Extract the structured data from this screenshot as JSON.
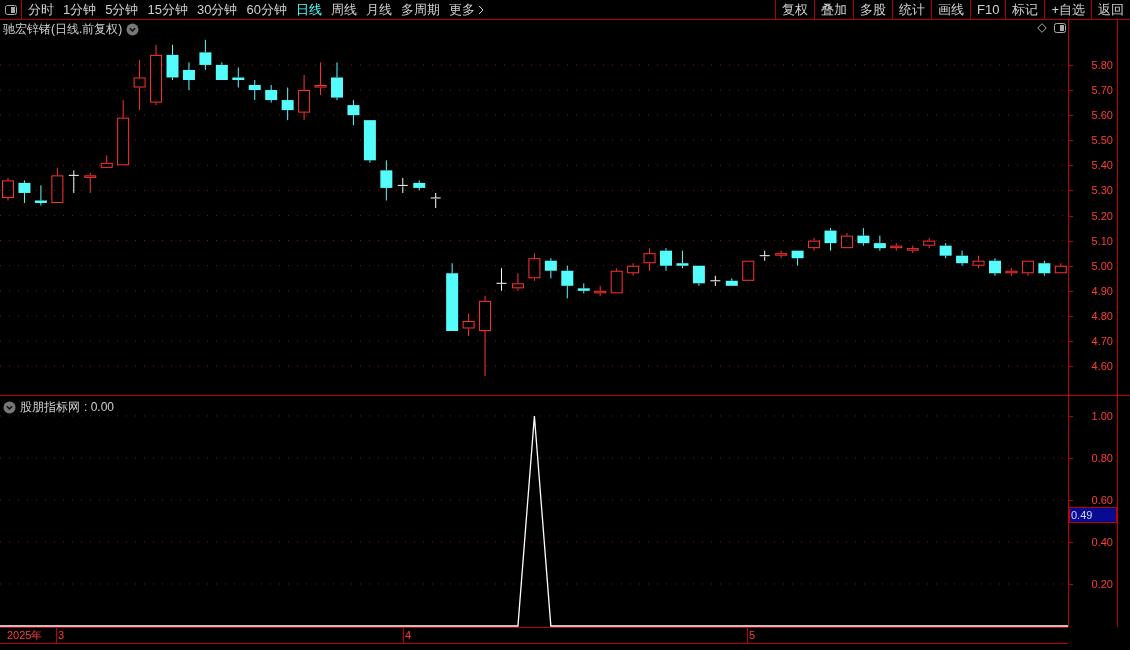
{
  "toolbar": {
    "periods": [
      {
        "label": "分时",
        "selected": false
      },
      {
        "label": "1分钟",
        "selected": false
      },
      {
        "label": "5分钟",
        "selected": false
      },
      {
        "label": "15分钟",
        "selected": false
      },
      {
        "label": "30分钟",
        "selected": false
      },
      {
        "label": "60分钟",
        "selected": false
      },
      {
        "label": "日线",
        "selected": true
      },
      {
        "label": "周线",
        "selected": false
      },
      {
        "label": "月线",
        "selected": false
      },
      {
        "label": "多周期",
        "selected": false
      }
    ],
    "more": "更多",
    "buttons": [
      "复权",
      "叠加",
      "多股",
      "统计",
      "画线",
      "F10",
      "标记",
      "+自选",
      "返回"
    ]
  },
  "main_panel": {
    "title": "驰宏锌锗(日线.前复权)",
    "chart_data": {
      "type": "candlestick",
      "grid": true,
      "ylim": [
        4.485,
        5.979
      ],
      "ohlc": [
        [
          5.27,
          5.35,
          5.26,
          5.34
        ],
        [
          5.33,
          5.34,
          5.25,
          5.29
        ],
        [
          5.26,
          5.32,
          5.24,
          5.25
        ],
        [
          5.25,
          5.39,
          5.25,
          5.36
        ],
        [
          5.36,
          5.38,
          5.29,
          5.36
        ],
        [
          5.35,
          5.37,
          5.29,
          5.36
        ],
        [
          5.39,
          5.44,
          5.39,
          5.41
        ],
        [
          5.4,
          5.66,
          5.4,
          5.59
        ],
        [
          5.71,
          5.82,
          5.62,
          5.75
        ],
        [
          5.65,
          5.88,
          5.64,
          5.84
        ],
        [
          5.84,
          5.88,
          5.74,
          5.75
        ],
        [
          5.78,
          5.81,
          5.7,
          5.74
        ],
        [
          5.85,
          5.9,
          5.78,
          5.8
        ],
        [
          5.8,
          5.81,
          5.74,
          5.74
        ],
        [
          5.75,
          5.79,
          5.71,
          5.74
        ],
        [
          5.72,
          5.74,
          5.66,
          5.7
        ],
        [
          5.7,
          5.72,
          5.65,
          5.66
        ],
        [
          5.66,
          5.71,
          5.58,
          5.62
        ],
        [
          5.61,
          5.76,
          5.58,
          5.7
        ],
        [
          5.71,
          5.81,
          5.68,
          5.72
        ],
        [
          5.75,
          5.81,
          5.66,
          5.67
        ],
        [
          5.64,
          5.66,
          5.56,
          5.6
        ],
        [
          5.58,
          5.58,
          5.41,
          5.42
        ],
        [
          5.38,
          5.42,
          5.26,
          5.31
        ],
        [
          5.32,
          5.35,
          5.29,
          5.32
        ],
        [
          5.33,
          5.34,
          5.3,
          5.31
        ],
        [
          5.27,
          5.29,
          5.23,
          5.27
        ],
        [
          4.97,
          5.01,
          4.74,
          4.74
        ],
        [
          4.75,
          4.81,
          4.72,
          4.78
        ],
        [
          4.74,
          4.88,
          4.56,
          4.86
        ],
        [
          4.93,
          4.99,
          4.9,
          4.93
        ],
        [
          4.91,
          4.97,
          4.9,
          4.93
        ],
        [
          4.95,
          5.05,
          4.94,
          5.03
        ],
        [
          5.02,
          5.03,
          4.95,
          4.98
        ],
        [
          4.98,
          5.0,
          4.87,
          4.92
        ],
        [
          4.91,
          4.93,
          4.89,
          4.9
        ],
        [
          4.89,
          4.92,
          4.88,
          4.9
        ],
        [
          4.89,
          4.99,
          4.89,
          4.98
        ],
        [
          4.97,
          5.01,
          4.96,
          5.0
        ],
        [
          5.01,
          5.07,
          4.98,
          5.05
        ],
        [
          5.06,
          5.07,
          4.98,
          5.0
        ],
        [
          5.01,
          5.06,
          4.99,
          5.0
        ],
        [
          5.0,
          5.0,
          4.92,
          4.93
        ],
        [
          4.94,
          4.96,
          4.92,
          4.94
        ],
        [
          4.94,
          4.95,
          4.92,
          4.92
        ],
        [
          4.94,
          5.02,
          4.94,
          5.02
        ],
        [
          5.04,
          5.06,
          5.02,
          5.04
        ],
        [
          5.04,
          5.06,
          5.03,
          5.05
        ],
        [
          5.06,
          5.06,
          5.0,
          5.03
        ],
        [
          5.07,
          5.11,
          5.06,
          5.1
        ],
        [
          5.14,
          5.15,
          5.06,
          5.09
        ],
        [
          5.07,
          5.13,
          5.07,
          5.12
        ],
        [
          5.12,
          5.15,
          5.08,
          5.09
        ],
        [
          5.09,
          5.12,
          5.06,
          5.07
        ],
        [
          5.07,
          5.09,
          5.06,
          5.08
        ],
        [
          5.06,
          5.08,
          5.05,
          5.07
        ],
        [
          5.08,
          5.11,
          5.07,
          5.1
        ],
        [
          5.08,
          5.09,
          5.03,
          5.04
        ],
        [
          5.04,
          5.06,
          5.0,
          5.01
        ],
        [
          5.0,
          5.04,
          4.99,
          5.02
        ],
        [
          5.02,
          5.03,
          4.96,
          4.97
        ],
        [
          4.97,
          4.99,
          4.96,
          4.98
        ],
        [
          4.97,
          5.02,
          4.96,
          5.02
        ],
        [
          5.01,
          5.02,
          4.96,
          4.97
        ],
        [
          4.97,
          5.01,
          4.97,
          5.0
        ]
      ],
      "yticks": [
        {
          "value": 5.8,
          "label": "5.80"
        },
        {
          "value": 5.7,
          "label": "5.70"
        },
        {
          "value": 5.6,
          "label": "5.60"
        },
        {
          "value": 5.5,
          "label": "5.50"
        },
        {
          "value": 5.4,
          "label": "5.40"
        },
        {
          "value": 5.3,
          "label": "5.30"
        },
        {
          "value": 5.2,
          "label": "5.20"
        },
        {
          "value": 5.1,
          "label": "5.10"
        },
        {
          "value": 5.0,
          "label": "5.00"
        },
        {
          "value": 4.9,
          "label": "4.90"
        },
        {
          "value": 4.8,
          "label": "4.80"
        },
        {
          "value": 4.7,
          "label": "4.70"
        },
        {
          "value": 4.6,
          "label": "4.60"
        }
      ]
    }
  },
  "indicator_panel": {
    "name": "股朋指标网",
    "value": ": 0.00",
    "cursor_value": "0.49",
    "chart_data": {
      "type": "line",
      "grid": true,
      "ylim": [
        0,
        1.095
      ],
      "series": [
        {
          "color": "#ffffff",
          "values": [
            0,
            0,
            0,
            0,
            0,
            0,
            0,
            0,
            0,
            0,
            0,
            0,
            0,
            0,
            0,
            0,
            0,
            0,
            0,
            0,
            0,
            0,
            0,
            0,
            0,
            0,
            0,
            0,
            0,
            0,
            0,
            0,
            1,
            0,
            0,
            0,
            0,
            0,
            0,
            0,
            0,
            0,
            0,
            0,
            0,
            0,
            0,
            0,
            0,
            0,
            0,
            0,
            0,
            0,
            0,
            0,
            0,
            0,
            0,
            0,
            0,
            0,
            0,
            0,
            0
          ]
        }
      ],
      "yticks": [
        {
          "value": 1,
          "label": "1.00"
        },
        {
          "value": 0.8,
          "label": "0.80"
        },
        {
          "value": 0.6,
          "label": "0.60"
        },
        {
          "value": 0.4,
          "label": "0.40"
        },
        {
          "value": 0.2,
          "label": "0.20"
        }
      ]
    }
  },
  "date_axis": {
    "year": "2025年",
    "months": [
      "3",
      "4",
      "5"
    ]
  }
}
